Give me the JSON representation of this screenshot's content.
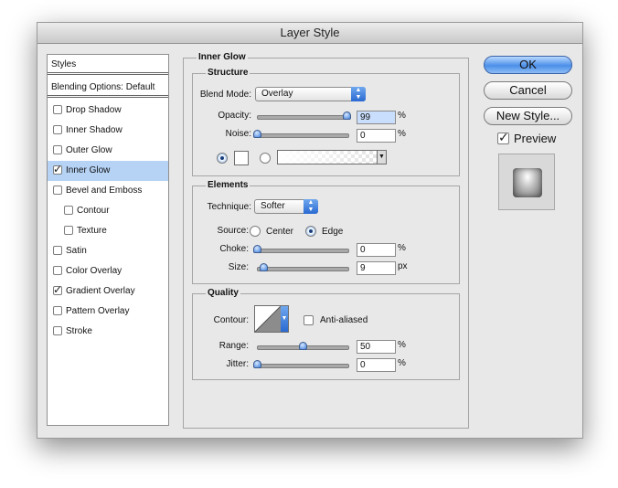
{
  "window": {
    "title": "Layer Style"
  },
  "styles_panel": {
    "header": "Styles",
    "blending": "Blending Options: Default",
    "items": [
      {
        "label": "Drop Shadow",
        "checked": false,
        "selected": false,
        "indent": false
      },
      {
        "label": "Inner Shadow",
        "checked": false,
        "selected": false,
        "indent": false
      },
      {
        "label": "Outer Glow",
        "checked": false,
        "selected": false,
        "indent": false
      },
      {
        "label": "Inner Glow",
        "checked": true,
        "selected": true,
        "indent": false
      },
      {
        "label": "Bevel and Emboss",
        "checked": false,
        "selected": false,
        "indent": false
      },
      {
        "label": "Contour",
        "checked": false,
        "selected": false,
        "indent": true
      },
      {
        "label": "Texture",
        "checked": false,
        "selected": false,
        "indent": true
      },
      {
        "label": "Satin",
        "checked": false,
        "selected": false,
        "indent": false
      },
      {
        "label": "Color Overlay",
        "checked": false,
        "selected": false,
        "indent": false
      },
      {
        "label": "Gradient Overlay",
        "checked": true,
        "selected": false,
        "indent": false
      },
      {
        "label": "Pattern Overlay",
        "checked": false,
        "selected": false,
        "indent": false
      },
      {
        "label": "Stroke",
        "checked": false,
        "selected": false,
        "indent": false
      }
    ]
  },
  "inner_glow": {
    "title": "Inner Glow",
    "structure": {
      "title": "Structure",
      "blend_mode_label": "Blend Mode:",
      "blend_mode_value": "Overlay",
      "opacity_label": "Opacity:",
      "opacity_value": "99",
      "opacity_fraction": 0.99,
      "opacity_unit": "%",
      "noise_label": "Noise:",
      "noise_value": "0",
      "noise_fraction": 0.0,
      "noise_unit": "%",
      "color_radio_selected": true,
      "gradient_radio_selected": false
    },
    "elements": {
      "title": "Elements",
      "technique_label": "Technique:",
      "technique_value": "Softer",
      "source_label": "Source:",
      "source_center": "Center",
      "source_edge": "Edge",
      "source_selected": "Edge",
      "choke_label": "Choke:",
      "choke_value": "0",
      "choke_fraction": 0.0,
      "choke_unit": "%",
      "size_label": "Size:",
      "size_value": "9",
      "size_fraction": 0.07,
      "size_unit": "px"
    },
    "quality": {
      "title": "Quality",
      "contour_label": "Contour:",
      "anti_aliased_label": "Anti-aliased",
      "anti_aliased": false,
      "range_label": "Range:",
      "range_value": "50",
      "range_fraction": 0.5,
      "range_unit": "%",
      "jitter_label": "Jitter:",
      "jitter_value": "0",
      "jitter_fraction": 0.0,
      "jitter_unit": "%"
    }
  },
  "buttons": {
    "ok": "OK",
    "cancel": "Cancel",
    "new_style": "New Style...",
    "preview_label": "Preview",
    "preview_checked": true
  },
  "colors": {
    "selection": "#b6d3f5",
    "accent": "#3f7fdc",
    "glow_color": "#ffffff"
  },
  "icons": {
    "dropdown": "chevron-double-icon",
    "checkmark": "checkmark-icon",
    "contour": "contour-linear-icon"
  }
}
